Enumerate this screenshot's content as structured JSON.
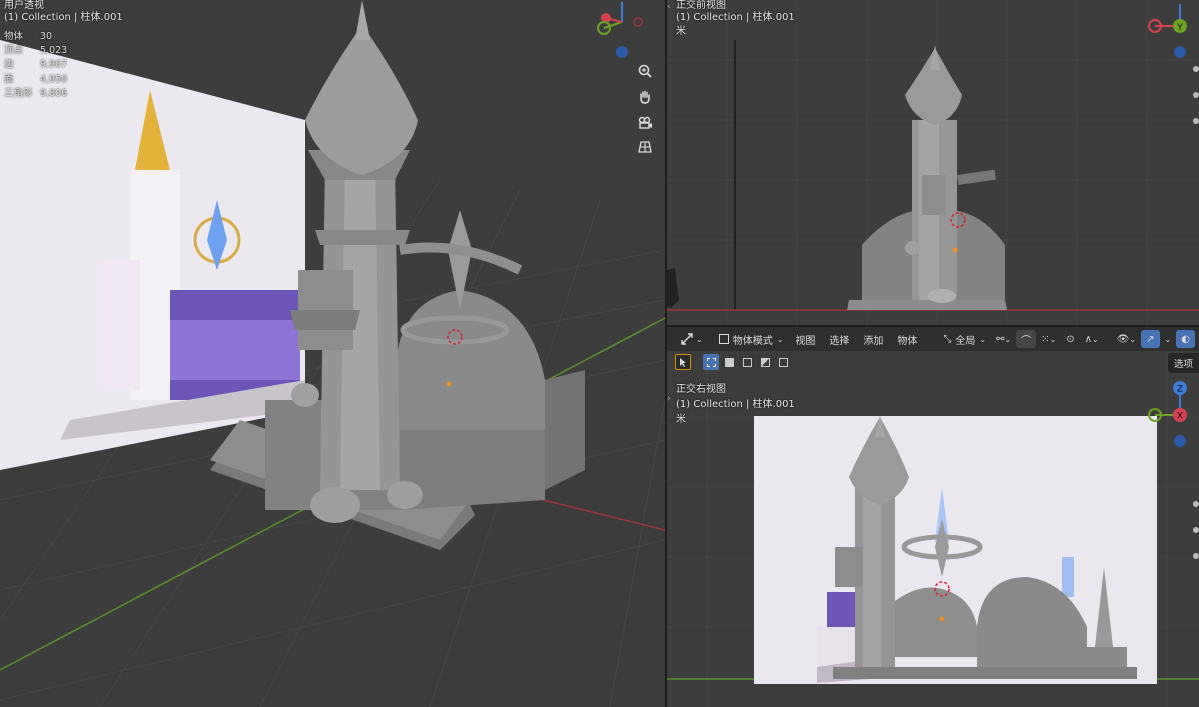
{
  "left_viewport": {
    "view_name": "用户透视",
    "collection": "(1) Collection | 柱体.001",
    "stats": [
      {
        "label": "物体",
        "value": "30"
      },
      {
        "label": "顶点",
        "value": "5,023"
      },
      {
        "label": "边",
        "value": "9,907"
      },
      {
        "label": "面",
        "value": "4,950"
      },
      {
        "label": "三角形",
        "value": "9,806"
      }
    ],
    "nav_icons": [
      "zoom-icon",
      "hand-pan-icon",
      "camera-icon",
      "grid-perspective-icon"
    ]
  },
  "top_right_viewport": {
    "view_name": "正交前视图",
    "collection": "(1) Collection | 柱体.001",
    "units": "米",
    "gizmo_axis_label": "Y"
  },
  "bottom_right_viewport": {
    "header": {
      "editor_icon": "transform-icon",
      "mode": "物体模式",
      "menus": [
        "视图",
        "选择",
        "添加",
        "物体"
      ],
      "transform_orientation": "全局",
      "tooltip": "选项"
    },
    "view_name": "正交右视图",
    "collection": "(1) Collection | 柱体.001",
    "units": "米",
    "gizmo_axis_label_top": "Z",
    "gizmo_axis_label_right": "X"
  },
  "colors": {
    "viewport_bg": "#3d3d3d",
    "header_bg": "#2f2f2f",
    "accent": "#4772b3",
    "axis_x": "#d9404f",
    "axis_y": "#6da320",
    "axis_z": "#3b7bd9",
    "model_gray": "#8c8c8c"
  }
}
